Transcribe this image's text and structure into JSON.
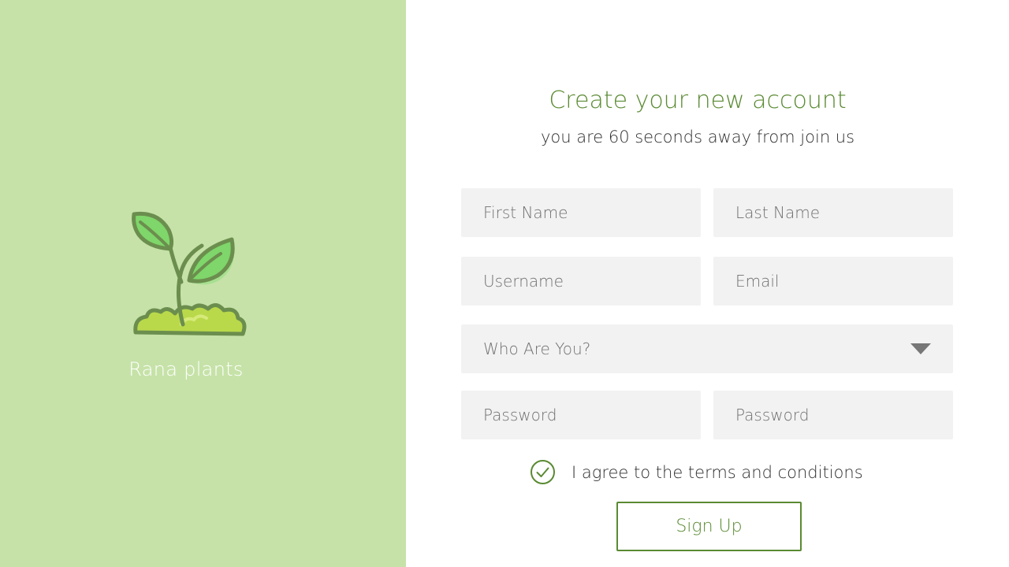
{
  "brand": {
    "name": "Rana plants",
    "logo_icon": "sprout-icon",
    "panel_color": "#c6e2a8"
  },
  "form": {
    "title": "Create your new account",
    "subtitle": "you are 60 seconds away from join us",
    "first_name_placeholder": "First Name",
    "last_name_placeholder": "Last Name",
    "username_placeholder": "Username",
    "email_placeholder": "Email",
    "role_select": {
      "selected": "Who Are You?",
      "icon": "caret-down-icon"
    },
    "password_placeholder": "Password",
    "confirm_password_placeholder": "Password",
    "terms_checked": true,
    "terms_label": "I agree to the terms and conditions",
    "submit_label": "Sign Up"
  },
  "colors": {
    "accent": "#5a8a32",
    "field_bg": "#f2f2f2"
  }
}
